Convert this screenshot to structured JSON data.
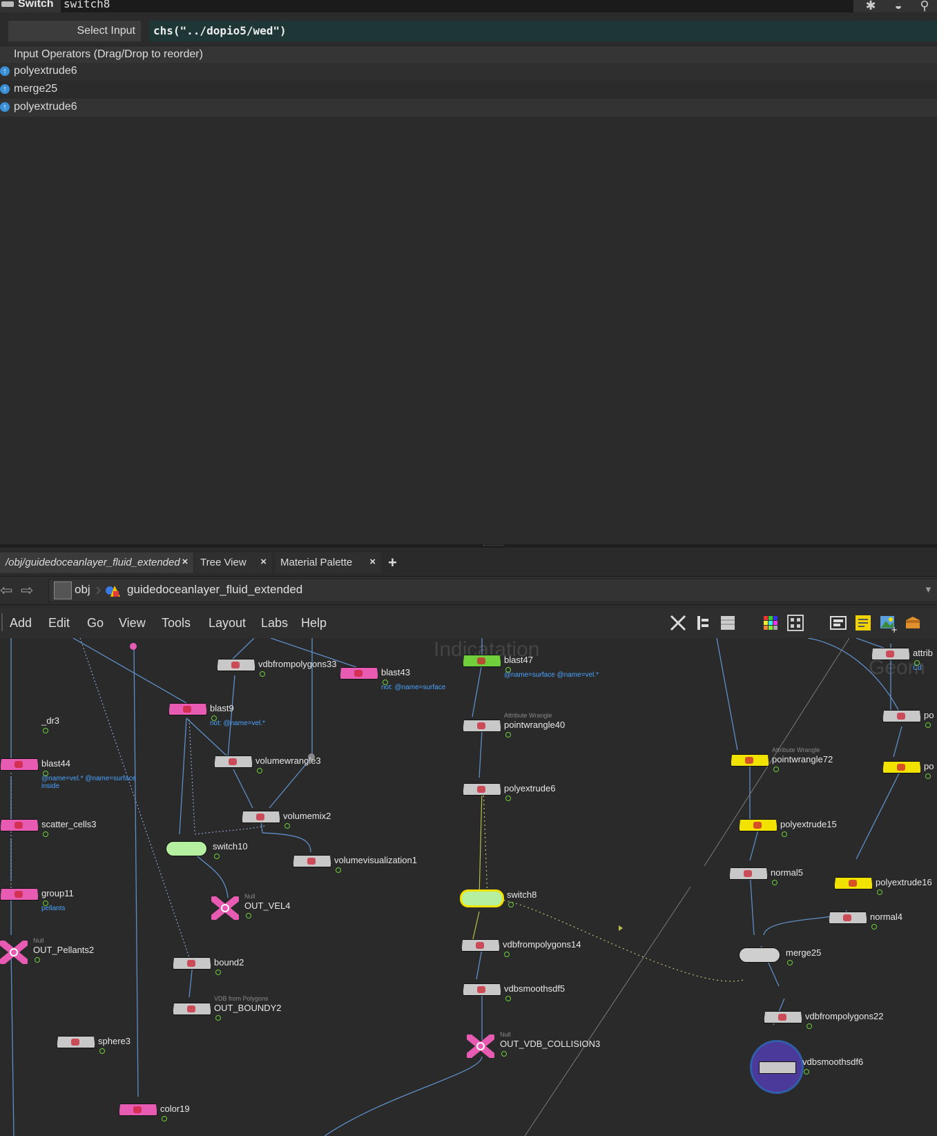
{
  "param_header": {
    "node_type": "Switch",
    "node_name": "switch8",
    "icons": [
      "gear-icon",
      "helmet-icon",
      "search-icon"
    ]
  },
  "select_input": {
    "label": "Select Input",
    "expression": "chs(\"../dopio5/wed\")"
  },
  "input_operators": {
    "header": "Input Operators (Drag/Drop to reorder)",
    "items": [
      {
        "label": "polyextrude6"
      },
      {
        "label": "merge25"
      },
      {
        "label": "polyextrude6"
      }
    ]
  },
  "tabs": [
    {
      "label": "/obj/guidedoceanlayer_fluid_extended",
      "close": "×"
    },
    {
      "label": "Tree View",
      "close": "×"
    },
    {
      "label": "Material Palette",
      "close": "×"
    }
  ],
  "add_tab": "+",
  "path": {
    "root": "obj",
    "network": "guidedoceanlayer_fluid_extended"
  },
  "menu": [
    "Add",
    "Edit",
    "Go",
    "View",
    "Tools",
    "Layout",
    "Labs",
    "Help"
  ],
  "network": {
    "watermarks": [
      "Indicatation",
      "Geom"
    ],
    "nodes": [
      {
        "name": "vdbfrompolygons33",
        "color": "#c8c8c8"
      },
      {
        "name": "blast43",
        "color": "#e85bb3",
        "comment": "not: @name=surface"
      },
      {
        "name": "blast47",
        "color": "#6fd03c",
        "comment": "@name=surface @name=vel.*"
      },
      {
        "name": "blast9",
        "color": "#e85bb3",
        "comment": "not: @name=vel.*"
      },
      {
        "name": "pointwrangle40",
        "color": "#c8c8c8",
        "subtype": "Attribute Wrangle"
      },
      {
        "name": "blast44",
        "color": "#e85bb3",
        "comment": "@name=vel.* @name=surface inside"
      },
      {
        "name": "volumewrangle3",
        "color": "#c8c8c8"
      },
      {
        "name": "pointwrangle72",
        "color": "#f2e200",
        "subtype": "Attribute Wrangle"
      },
      {
        "name": "polyextrude6",
        "color": "#c8c8c8"
      },
      {
        "name": "volumemix2",
        "color": "#c8c8c8"
      },
      {
        "name": "scatter_cells3",
        "color": "#e85bb3"
      },
      {
        "name": "polyextrude15",
        "color": "#f2e200"
      },
      {
        "name": "switch10",
        "color": "#b5f0a0"
      },
      {
        "name": "volumevisualization1",
        "color": "#c8c8c8"
      },
      {
        "name": "normal5",
        "color": "#c8c8c8"
      },
      {
        "name": "polyextrude16",
        "color": "#f2e200"
      },
      {
        "name": "group11",
        "color": "#e85bb3",
        "comment": "pellants"
      },
      {
        "name": "switch8",
        "color": "#b5f0a0"
      },
      {
        "name": "OUT_VEL4",
        "color": "#e85bb3",
        "subtype": "Null"
      },
      {
        "name": "normal4",
        "color": "#c8c8c8"
      },
      {
        "name": "OUT_Pellants2",
        "color": "#e85bb3",
        "subtype": "Null"
      },
      {
        "name": "vdbfrompolygons14",
        "color": "#c8c8c8"
      },
      {
        "name": "merge25",
        "color": "#c8c8c8"
      },
      {
        "name": "bound2",
        "color": "#c8c8c8"
      },
      {
        "name": "vdbsmoothsdf5",
        "color": "#c8c8c8"
      },
      {
        "name": "OUT_BOUNDY2",
        "color": "#c8c8c8",
        "subtype": "VDB from Polygons"
      },
      {
        "name": "vdbfrompolygons22",
        "color": "#c8c8c8"
      },
      {
        "name": "sphere3",
        "color": "#c8c8c8"
      },
      {
        "name": "OUT_VDB_COLLISION3",
        "color": "#e85bb3",
        "subtype": "Null"
      },
      {
        "name": "vdbsmoothsdf6",
        "color": "#c8c8c8"
      },
      {
        "name": "color19",
        "color": "#e85bb3"
      },
      {
        "name": "attrib",
        "color": "#c8c8c8",
        "comment": "Cd"
      },
      {
        "name": "po",
        "color": "#c8c8c8"
      },
      {
        "name": "po",
        "color": "#f2e200"
      },
      {
        "name": "_dr3",
        "color": "#c8c8c8"
      }
    ]
  }
}
